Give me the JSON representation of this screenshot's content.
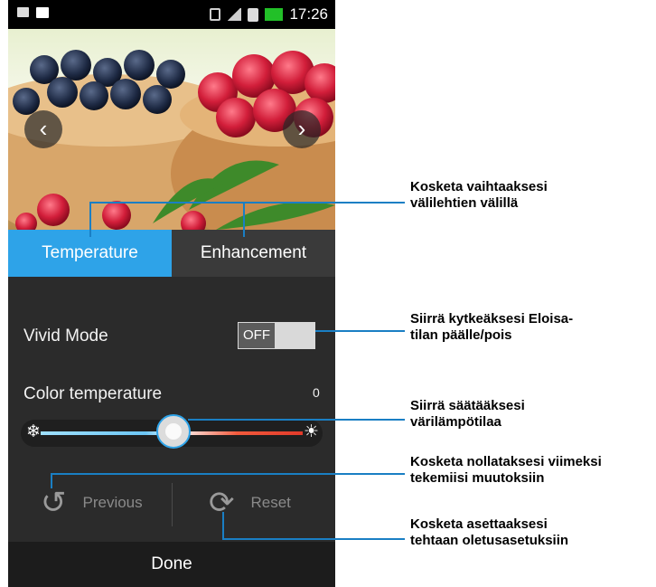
{
  "statusbar": {
    "time": "17:26"
  },
  "nav": {
    "prev_glyph": "‹",
    "next_glyph": "›"
  },
  "tabs": {
    "temperature": "Temperature",
    "enhancement": "Enhancement"
  },
  "vivid_mode": {
    "label": "Vivid Mode",
    "state": "OFF"
  },
  "color_temperature": {
    "label": "Color temperature",
    "value": "0",
    "level": 0.5
  },
  "actions": {
    "previous": "Previous",
    "reset": "Reset",
    "done": "Done"
  },
  "callouts": {
    "tabs": "Kosketa vaihtaaksesi\nvälilehtien välillä",
    "vivid": "Siirrä kytkeäksesi Eloisa-\ntilan päälle/pois",
    "slider": "Siirrä säätääksesi\nvärilämpötilaa",
    "previous": "Kosketa nollataksesi viimeksi\ntekemiisi muutoksiin",
    "reset": "Kosketa asettaaksesi\ntehtaan oletusasetuksiin"
  },
  "colors": {
    "accent": "#2ea3e8",
    "callout_line": "#1a7fc4"
  }
}
